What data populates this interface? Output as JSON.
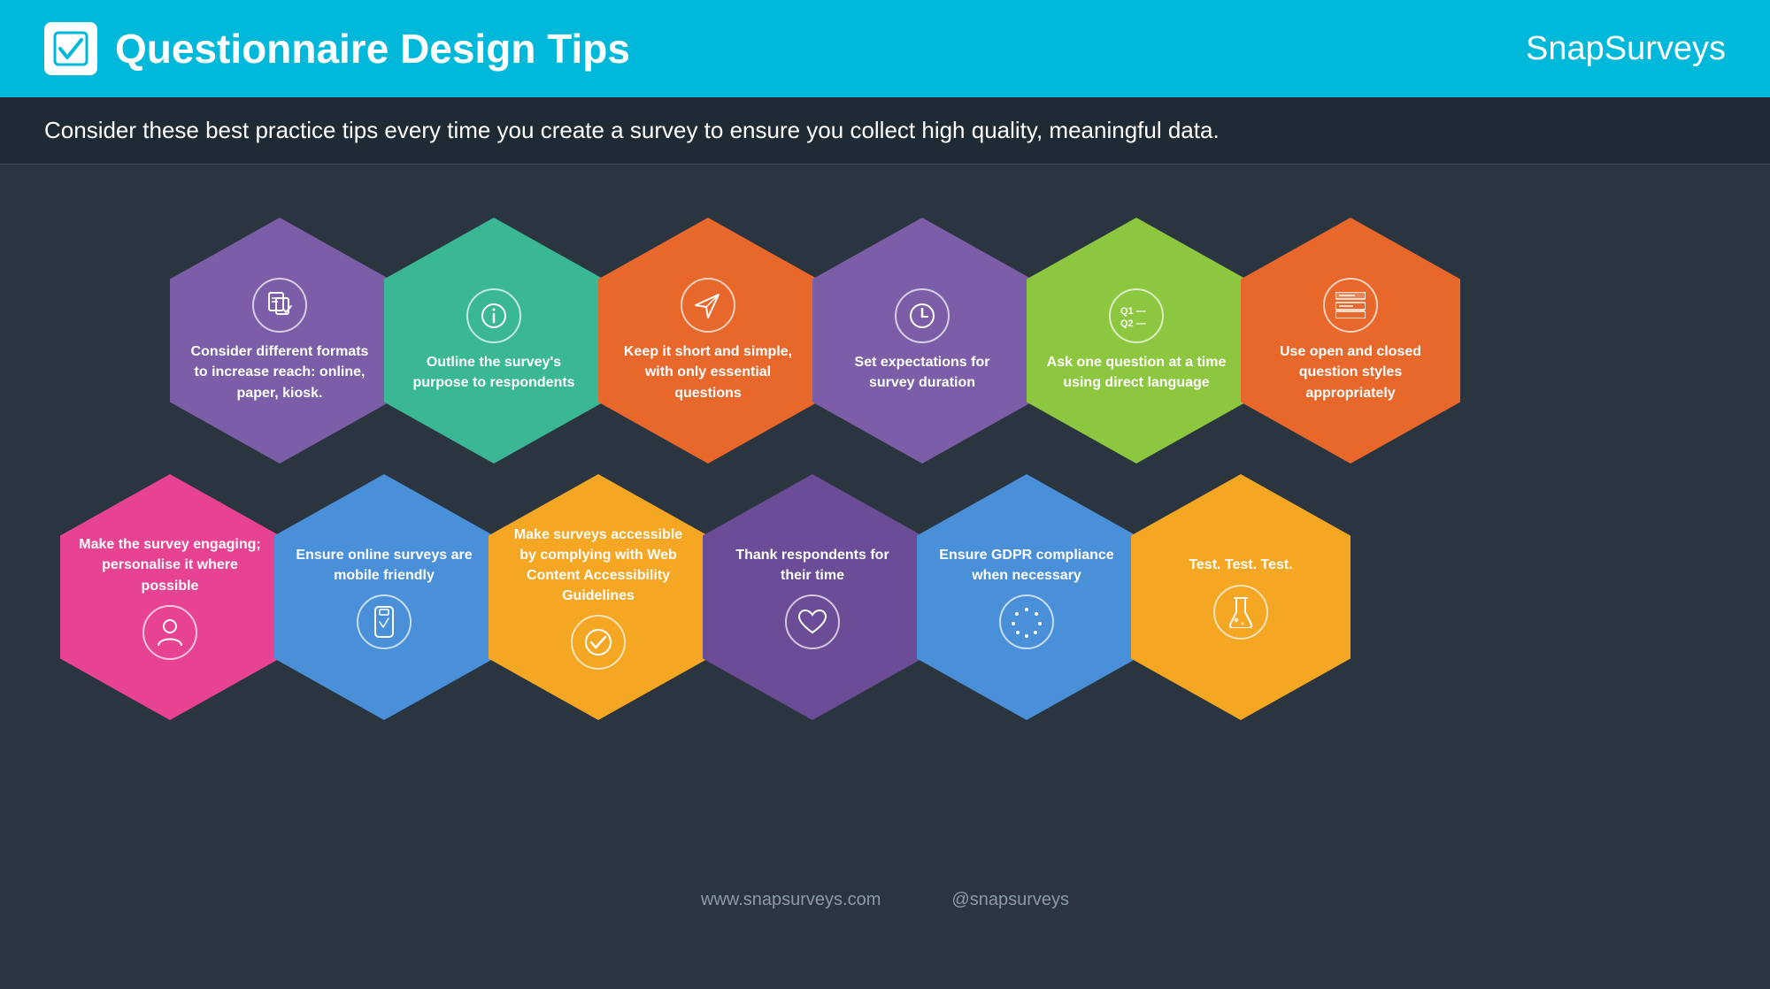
{
  "header": {
    "title": "Questionnaire Design Tips",
    "brand_snap": "Snap",
    "brand_surveys": "Surveys",
    "checkbox_icon": "✔"
  },
  "subtitle": "Consider these best practice tips every time you create a survey to ensure you collect high quality, meaningful data.",
  "tips_row1": [
    {
      "id": "tip1",
      "color": "#7b5ea7",
      "text": "Consider different formats to increase reach: online, paper, kiosk.",
      "icon": "forms"
    },
    {
      "id": "tip2",
      "color": "#3ab795",
      "text": "Outline the survey's purpose to respondents",
      "icon": "info"
    },
    {
      "id": "tip3",
      "color": "#e8672a",
      "text": "Keep it short and simple, with only essential questions",
      "icon": "send"
    },
    {
      "id": "tip4",
      "color": "#7b5ea7",
      "text": "Set expectations for survey duration",
      "icon": "clock"
    },
    {
      "id": "tip5",
      "color": "#8dc63f",
      "text": "Ask one question at a time using direct language",
      "icon": "q1q2"
    },
    {
      "id": "tip6",
      "color": "#e8672a",
      "text": "Use open and closed question styles appropriately",
      "icon": "list"
    }
  ],
  "tips_row2": [
    {
      "id": "tip7",
      "color": "#e84393",
      "text": "Make the survey engaging; personalise it where possible",
      "icon": "person"
    },
    {
      "id": "tip8",
      "color": "#4a90d9",
      "text": "Ensure online surveys are mobile friendly",
      "icon": "mobile"
    },
    {
      "id": "tip9",
      "color": "#f5a623",
      "text": "Make surveys accessible by complying with Web Content Accessibility Guidelines",
      "icon": "check-circle"
    },
    {
      "id": "tip10",
      "color": "#6b4c96",
      "text": "Thank respondents for their time",
      "icon": "heart"
    },
    {
      "id": "tip11",
      "color": "#4a90d9",
      "text": "Ensure GDPR compliance when necessary",
      "icon": "stars"
    },
    {
      "id": "tip12",
      "color": "#f5a623",
      "text": "Test. Test. Test.",
      "icon": "flask"
    }
  ],
  "footer": {
    "website": "www.snapsurveys.com",
    "twitter": "@snapsurveys"
  }
}
